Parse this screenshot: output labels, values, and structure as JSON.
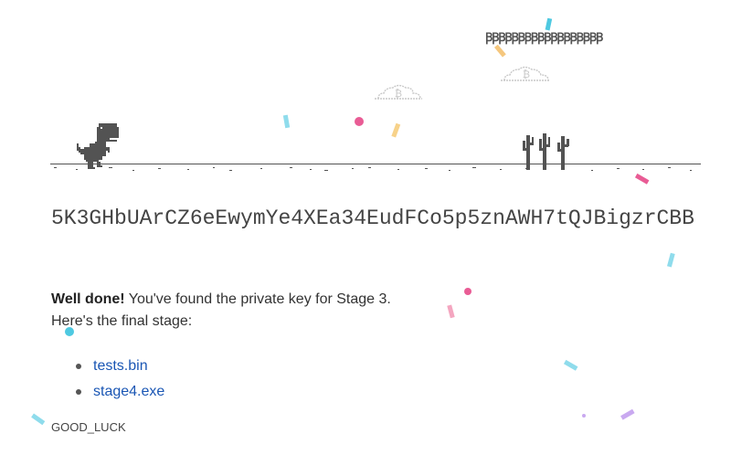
{
  "game": {
    "score_display": "ꞴꞴꞴꞴꞴꞴꞴꞴꞴꞴꞴꞴꞴꞴꞴꞴꞴꞴ",
    "cloud_symbol": "₿",
    "colors": {
      "sprite": "#535353",
      "cloud": "#c8c8c8"
    },
    "confetti_colors": [
      "#4ec9e1",
      "#f5c77e",
      "#e95c95",
      "#f7d28a",
      "#f4a6c0",
      "#c9a9f0"
    ]
  },
  "content": {
    "private_key": "5K3GHbUArCZ6eEwymYe4XEa34EudFCo5p5znAWH7tQJBigzrCBB",
    "message_bold": "Well done!",
    "message_rest": "You've found the private key for Stage 3.",
    "message_line2": "Here's the final stage:",
    "files": [
      {
        "label": "tests.bin"
      },
      {
        "label": "stage4.exe"
      }
    ],
    "footer_code": "GOOD_LUCK"
  }
}
